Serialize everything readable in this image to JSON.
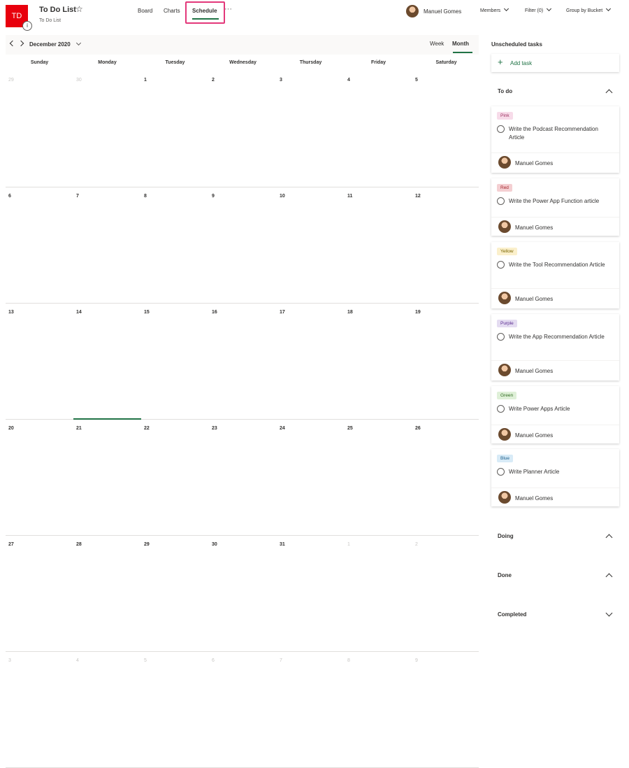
{
  "app": {
    "initials": "TD",
    "plan_title": "To Do List",
    "plan_subtitle": "To Do List",
    "info_glyph": "i",
    "star_glyph": "☆",
    "ellipsis_glyph": "···"
  },
  "nav": {
    "tabs": [
      "Board",
      "Charts",
      "Schedule"
    ],
    "selected": "Schedule"
  },
  "header": {
    "user_name": "Manuel Gomes",
    "members_label": "Members",
    "filter_label": "Filter (0)",
    "group_label": "Group by Bucket"
  },
  "calendar": {
    "month_label": "December 2020",
    "view_week": "Week",
    "view_month": "Month",
    "selected_view": "Month",
    "day_headers": [
      "Sunday",
      "Monday",
      "Tuesday",
      "Wednesday",
      "Thursday",
      "Friday",
      "Saturday"
    ],
    "today": "21",
    "weeks": [
      [
        {
          "d": "29",
          "muted": true
        },
        {
          "d": "30",
          "muted": true
        },
        {
          "d": "1",
          "muted": false
        },
        {
          "d": "2",
          "muted": false
        },
        {
          "d": "3",
          "muted": false
        },
        {
          "d": "4",
          "muted": false
        },
        {
          "d": "5",
          "muted": false
        }
      ],
      [
        {
          "d": "6",
          "muted": false
        },
        {
          "d": "7",
          "muted": false
        },
        {
          "d": "8",
          "muted": false
        },
        {
          "d": "9",
          "muted": false
        },
        {
          "d": "10",
          "muted": false
        },
        {
          "d": "11",
          "muted": false
        },
        {
          "d": "12",
          "muted": false
        }
      ],
      [
        {
          "d": "13",
          "muted": false
        },
        {
          "d": "14",
          "muted": false
        },
        {
          "d": "15",
          "muted": false
        },
        {
          "d": "16",
          "muted": false
        },
        {
          "d": "17",
          "muted": false
        },
        {
          "d": "18",
          "muted": false
        },
        {
          "d": "19",
          "muted": false
        }
      ],
      [
        {
          "d": "20",
          "muted": false
        },
        {
          "d": "21",
          "muted": false
        },
        {
          "d": "22",
          "muted": false
        },
        {
          "d": "23",
          "muted": false
        },
        {
          "d": "24",
          "muted": false
        },
        {
          "d": "25",
          "muted": false
        },
        {
          "d": "26",
          "muted": false
        }
      ],
      [
        {
          "d": "27",
          "muted": false
        },
        {
          "d": "28",
          "muted": false
        },
        {
          "d": "29",
          "muted": false
        },
        {
          "d": "30",
          "muted": false
        },
        {
          "d": "31",
          "muted": false
        },
        {
          "d": "1",
          "muted": true
        },
        {
          "d": "2",
          "muted": true
        }
      ],
      [
        {
          "d": "3",
          "muted": true
        },
        {
          "d": "4",
          "muted": true
        },
        {
          "d": "5",
          "muted": true
        },
        {
          "d": "6",
          "muted": true
        },
        {
          "d": "7",
          "muted": true
        },
        {
          "d": "8",
          "muted": true
        },
        {
          "d": "9",
          "muted": true
        }
      ]
    ]
  },
  "sidebar": {
    "title": "Unscheduled tasks",
    "add_task_label": "Add task",
    "add_glyph": "+",
    "buckets": [
      {
        "name": "To do",
        "state": "expanded"
      },
      {
        "name": "Doing",
        "state": "expanded"
      },
      {
        "name": "Done",
        "state": "expanded"
      },
      {
        "name": "Completed",
        "state": "collapsed"
      }
    ],
    "tasks": [
      {
        "label": "Pink",
        "label_bg": "#f7dbe9",
        "label_fg": "#9b2f5f",
        "title": "Write the Podcast Recommendation Article",
        "assignee": "Manuel Gomes"
      },
      {
        "label": "Red",
        "label_bg": "#f4cfd2",
        "label_fg": "#a4262c",
        "title": "Write the Power App Function article",
        "assignee": "Manuel Gomes"
      },
      {
        "label": "Yellow",
        "label_bg": "#fbf0cc",
        "label_fg": "#7a6400",
        "title": "Write the Tool Recommendation Article",
        "assignee": "Manuel Gomes"
      },
      {
        "label": "Purple",
        "label_bg": "#e4dcf1",
        "label_fg": "#5c2e91",
        "title": "Write the App Recommendation Article",
        "assignee": "Manuel Gomes"
      },
      {
        "label": "Green",
        "label_bg": "#dff0d8",
        "label_fg": "#2f6b1f",
        "title": "Write Power Apps Article",
        "assignee": "Manuel Gomes"
      },
      {
        "label": "Blue",
        "label_bg": "#d8ebf7",
        "label_fg": "#1a5e8a",
        "title": "Write Planner Article",
        "assignee": "Manuel Gomes"
      }
    ]
  },
  "colors": {
    "brand_red": "#e8000d",
    "accent_green": "#217346",
    "highlight_pink": "#e3387a"
  }
}
